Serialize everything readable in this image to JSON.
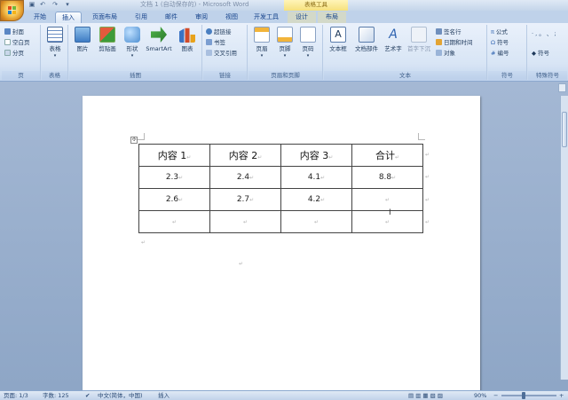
{
  "title_bar": {
    "doc_title": "文档 1 (自动保存的) - Microsoft Word",
    "context_tab_title": "表格工具"
  },
  "tabs": [
    {
      "label": "开始"
    },
    {
      "label": "插入"
    },
    {
      "label": "页面布局"
    },
    {
      "label": "引用"
    },
    {
      "label": "邮件"
    },
    {
      "label": "审阅"
    },
    {
      "label": "视图"
    },
    {
      "label": "开发工具"
    },
    {
      "label": "设计"
    },
    {
      "label": "布局"
    }
  ],
  "active_tab": "插入",
  "ribbon": {
    "pages": {
      "label": "页",
      "cover": "封面",
      "blank": "空白页",
      "break": "分页"
    },
    "tables": {
      "label": "表格",
      "table": "表格"
    },
    "illustrations": {
      "label": "插图",
      "picture": "图片",
      "clipart": "剪贴画",
      "shapes": "形状",
      "smartart": "SmartArt",
      "chart": "图表"
    },
    "links": {
      "label": "链接",
      "hyperlink": "超链接",
      "bookmark": "书签",
      "crossref": "交叉引用"
    },
    "header_footer": {
      "label": "页眉和页脚",
      "header": "页眉",
      "footer": "页脚",
      "page_number": "页码"
    },
    "text": {
      "label": "文本",
      "textbox": "文本框",
      "quickparts": "文档部件",
      "wordart": "艺术字",
      "dropcap": "首字下沉",
      "signature": "签名行",
      "datetime": "日期和时间",
      "object": "对象"
    },
    "symbols": {
      "label": "符号",
      "equation": "公式",
      "symbol": "符号",
      "number": "编号"
    },
    "special": {
      "label": "特殊符号",
      "item": "符号"
    }
  },
  "table": {
    "headers": [
      "内容 1",
      "内容 2",
      "内容 3",
      "合计"
    ],
    "rows": [
      [
        "2.3",
        "2.4",
        "4.1",
        "8.8"
      ],
      [
        "2.6",
        "2.7",
        "4.2",
        ""
      ],
      [
        "",
        "",
        "",
        ""
      ]
    ]
  },
  "status": {
    "page": "页面: 1/3",
    "words": "字数: 125",
    "language": "中文(简体，中国)",
    "mode": "插入",
    "zoom": "90%"
  },
  "colors": {
    "ribbon_bg": "#dbe7f6",
    "accent": "#15428b",
    "context_tab": "#f6e17d"
  }
}
